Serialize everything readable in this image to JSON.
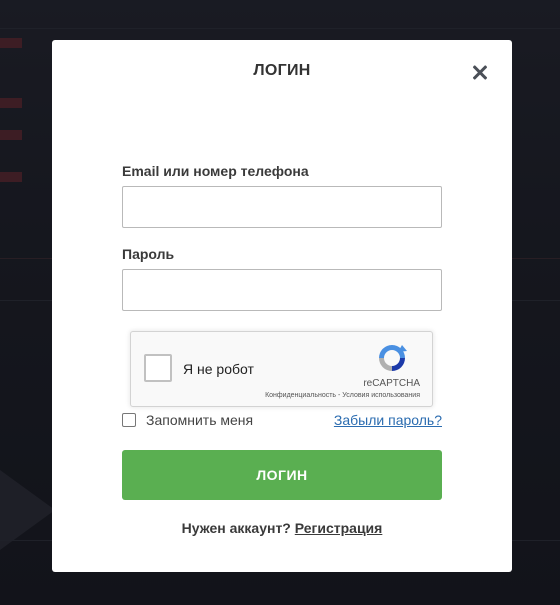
{
  "modal": {
    "title": "ЛОГИН",
    "close_icon": "close-icon"
  },
  "form": {
    "email_label": "Email или номер телефона",
    "email_value": "",
    "password_label": "Пароль",
    "password_value": ""
  },
  "recaptcha": {
    "label": "Я не робот",
    "brand": "reCAPTCHA",
    "terms": "Конфиденциальность - Условия использования",
    "icon": "recaptcha-logo-icon"
  },
  "remember": {
    "label": "Запомнить меня",
    "checked": false
  },
  "forgot_label": "Забыли пароль?",
  "login_button": "ЛОГИН",
  "footer": {
    "prompt": "Нужен аккаунт?",
    "register_link": "Регистрация"
  },
  "colors": {
    "primary_button": "#5aaf51",
    "link": "#2b6cb0"
  }
}
